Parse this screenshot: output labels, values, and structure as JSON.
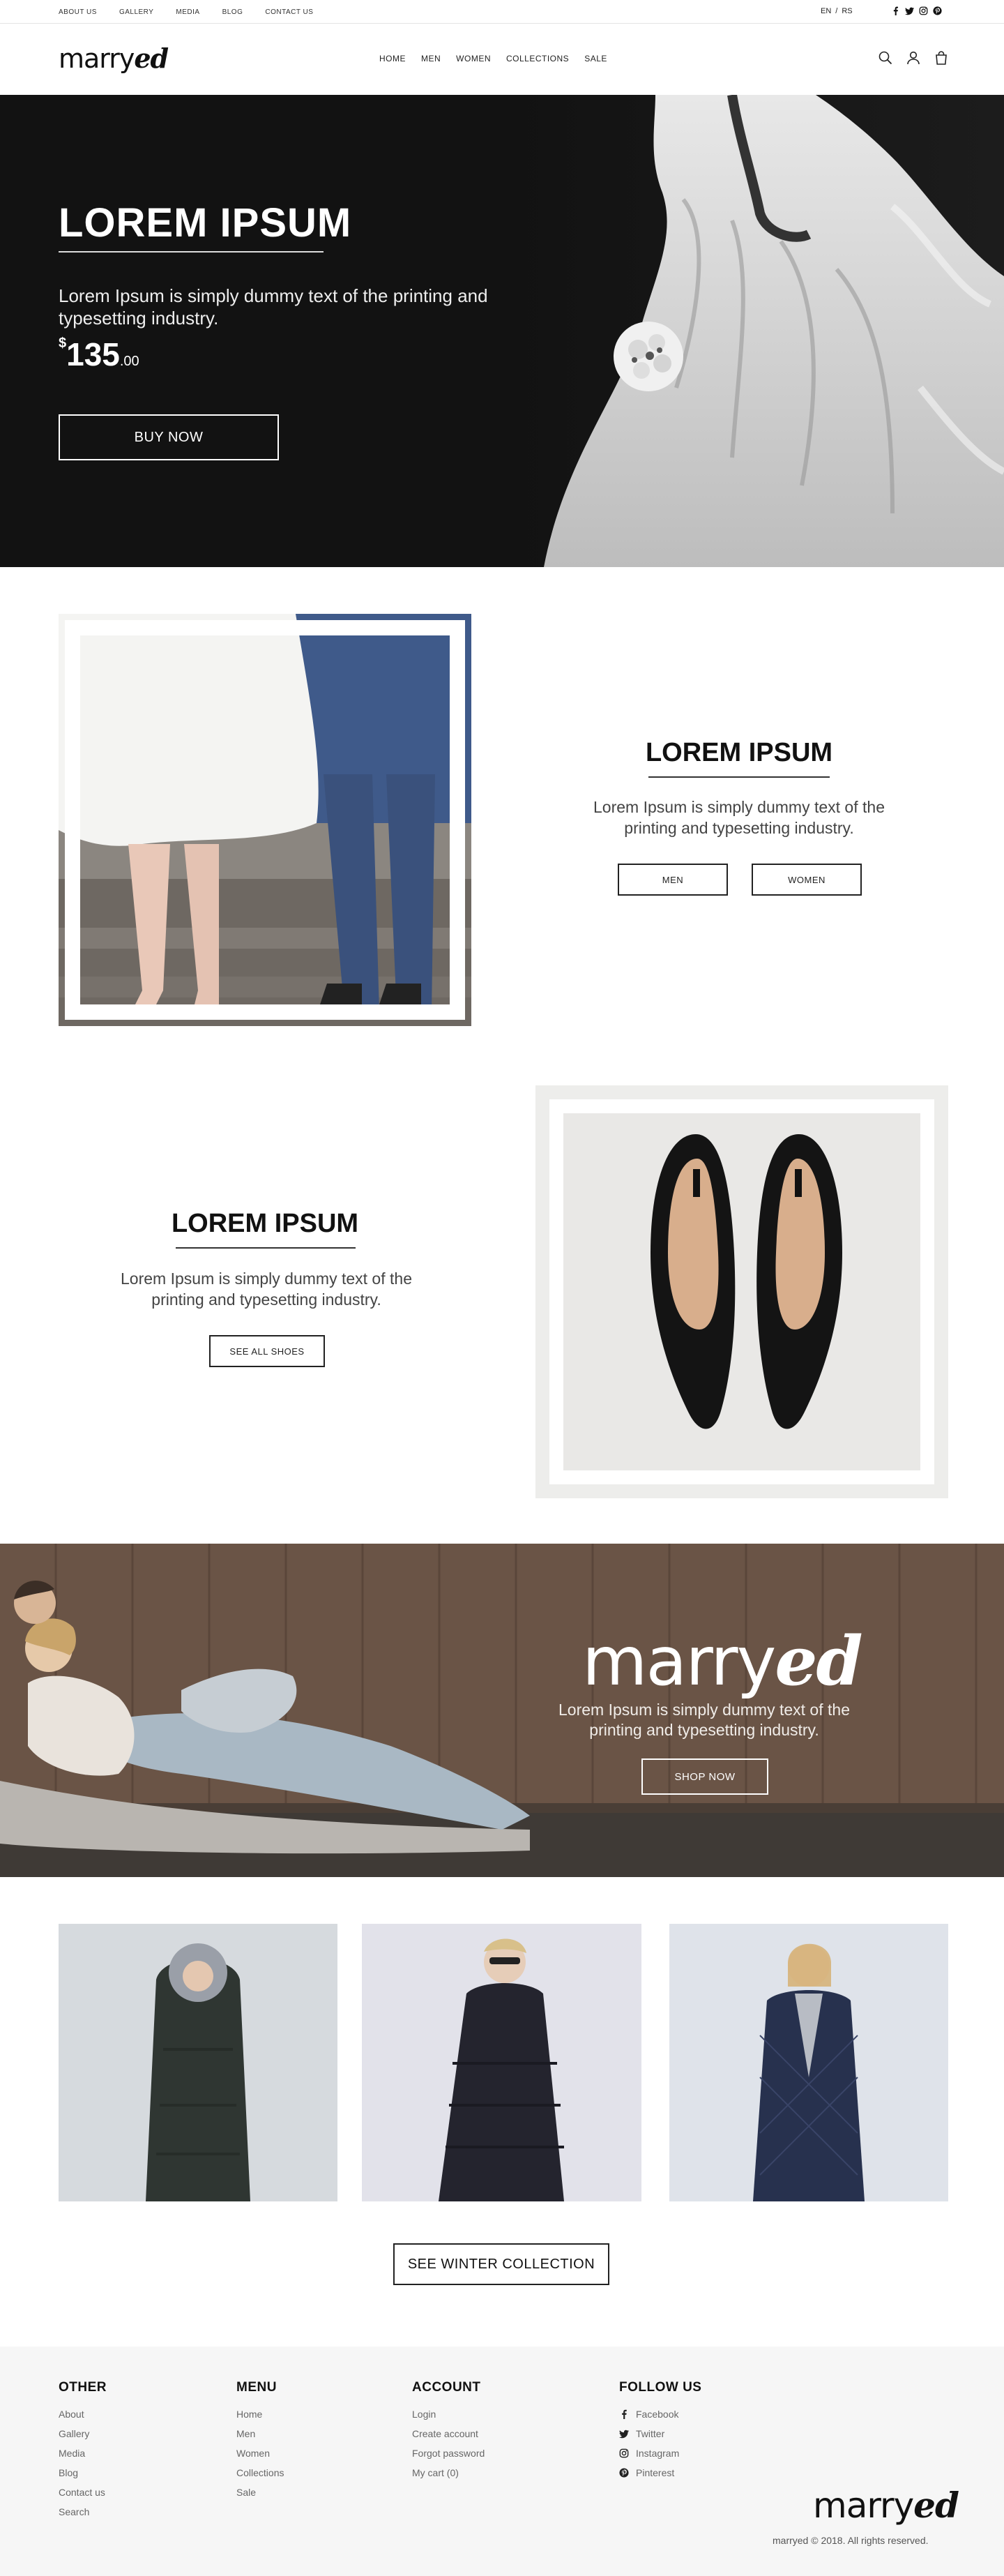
{
  "topbar": {
    "links": [
      "ABOUT US",
      "GALLERY",
      "MEDIA",
      "BLOG",
      "CONTACT US"
    ],
    "lang": {
      "en": "EN",
      "sep": "/",
      "rs": "RS"
    },
    "social_icons": [
      "facebook-icon",
      "twitter-icon",
      "instagram-icon",
      "pinterest-icon"
    ]
  },
  "header": {
    "logo_light": "marry",
    "logo_bold": "ed",
    "nav": [
      "HOME",
      "MEN",
      "WOMEN",
      "COLLECTIONS",
      "SALE"
    ],
    "icons": [
      "search-icon",
      "user-icon",
      "cart-icon"
    ]
  },
  "hero": {
    "title": "LOREM IPSUM",
    "text": "Lorem Ipsum is simply dummy text of the printing and typesetting industry.",
    "price_currency": "$",
    "price_main": "135",
    "price_cents": ".00",
    "button": "BUY NOW"
  },
  "section_couple": {
    "title": "LOREM IPSUM",
    "text": "Lorem Ipsum is simply dummy text of the printing and typesetting industry.",
    "btn_men": "MEN",
    "btn_women": "WOMEN"
  },
  "section_shoes": {
    "title": "LOREM IPSUM",
    "text": "Lorem Ipsum is simply dummy text of the printing and typesetting industry.",
    "button": "SEE ALL SHOES"
  },
  "banner": {
    "logo_light": "marry",
    "logo_bold": "ed",
    "text": "Lorem Ipsum is simply dummy text of the printing and typesetting industry.",
    "button": "SHOP NOW"
  },
  "products": {
    "button": "SEE WINTER COLLECTION"
  },
  "footer": {
    "other": {
      "title": "OTHER",
      "links": [
        "About",
        "Gallery",
        "Media",
        "Blog",
        "Contact us",
        "Search"
      ]
    },
    "menu": {
      "title": "MENU",
      "links": [
        "Home",
        "Men",
        "Women",
        "Collections",
        "Sale"
      ]
    },
    "account": {
      "title": "ACCOUNT",
      "links": [
        "Login",
        "Create account",
        "Forgot password",
        "My cart (0)"
      ]
    },
    "follow": {
      "title": "FOLLOW US",
      "links": [
        "Facebook",
        "Twitter",
        "Instagram",
        "Pinterest"
      ]
    },
    "logo_light": "marry",
    "logo_bold": "ed",
    "copyright": "marryed © 2018. All rights reserved."
  },
  "colors": {
    "hero_bg": "#121212",
    "banner_wood": "#6a5446",
    "footer_bg": "#f6f6f6"
  }
}
